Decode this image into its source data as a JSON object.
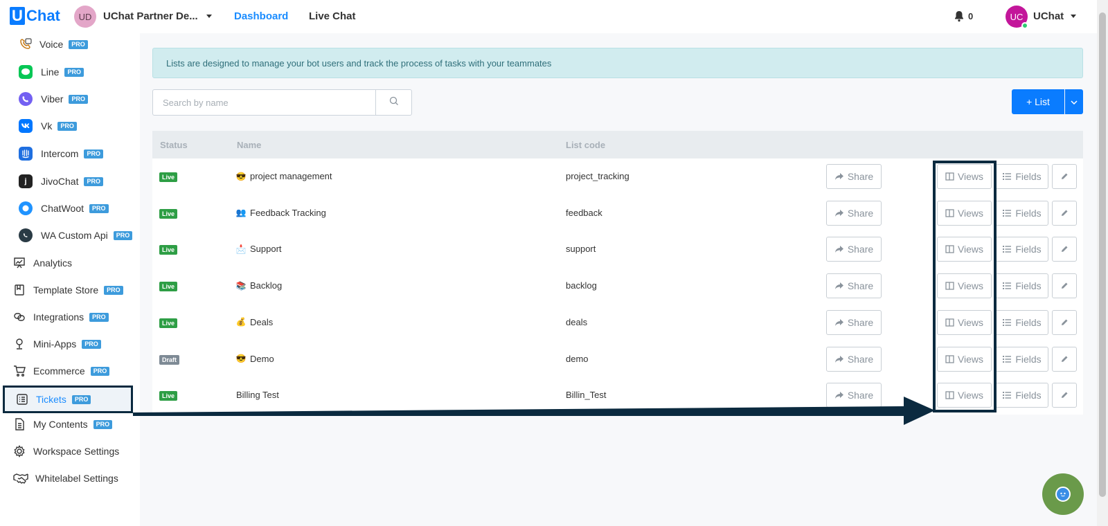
{
  "header": {
    "logo_letter": "U",
    "logo_text": "Chat",
    "workspace_initials": "UD",
    "workspace_name": "UChat Partner De...",
    "nav": {
      "dashboard": "Dashboard",
      "live_chat": "Live Chat"
    },
    "notification_count": "0",
    "user_initials": "UC",
    "user_name": "UChat"
  },
  "sidebar": {
    "pro_label": "PRO",
    "channels": [
      {
        "label": "Voice",
        "icon": "voice-icon",
        "color": "#f0a030"
      },
      {
        "label": "Line",
        "icon": "line-icon",
        "color": "#06c755"
      },
      {
        "label": "Viber",
        "icon": "viber-icon",
        "color": "#7360f2"
      },
      {
        "label": "Vk",
        "icon": "vk-icon",
        "color": "#0077ff"
      },
      {
        "label": "Intercom",
        "icon": "intercom-icon",
        "color": "#1f8ded"
      },
      {
        "label": "JivoChat",
        "icon": "jivochat-icon",
        "color": "#222222"
      },
      {
        "label": "ChatWoot",
        "icon": "chatwoot-icon",
        "color": "#1f93ff"
      },
      {
        "label": "WA Custom Api",
        "icon": "whatsapp-icon",
        "color": "#2a3b45"
      }
    ],
    "items": [
      {
        "label": "Analytics",
        "pro": false,
        "icon": "analytics-icon"
      },
      {
        "label": "Template Store",
        "pro": true,
        "icon": "template-store-icon"
      },
      {
        "label": "Integrations",
        "pro": true,
        "icon": "integrations-icon"
      },
      {
        "label": "Mini-Apps",
        "pro": true,
        "icon": "mini-apps-icon"
      },
      {
        "label": "Ecommerce",
        "pro": true,
        "icon": "ecommerce-icon"
      },
      {
        "label": "Tickets",
        "pro": true,
        "icon": "tickets-icon",
        "active": true
      },
      {
        "label": "My Contents",
        "pro": true,
        "icon": "my-contents-icon"
      },
      {
        "label": "Workspace Settings",
        "pro": false,
        "icon": "gear-icon"
      },
      {
        "label": "Whitelabel Settings",
        "pro": false,
        "icon": "handshake-icon"
      }
    ]
  },
  "main": {
    "alert": "Lists are designed to manage your bot users and track the process of tasks with your teammates",
    "search_placeholder": "Search by name",
    "add_list_label": "+ List",
    "columns": {
      "status": "Status",
      "name": "Name",
      "code": "List code"
    },
    "buttons": {
      "share": "Share",
      "views": "Views",
      "fields": "Fields"
    },
    "rows": [
      {
        "status": "Live",
        "name": "project management",
        "code": "project_tracking",
        "emoji": "😎"
      },
      {
        "status": "Live",
        "name": "Feedback Tracking",
        "code": "feedback",
        "emoji": "👥"
      },
      {
        "status": "Live",
        "name": "Support",
        "code": "support",
        "emoji": "📩"
      },
      {
        "status": "Live",
        "name": "Backlog",
        "code": "backlog",
        "emoji": "📚"
      },
      {
        "status": "Live",
        "name": "Deals",
        "code": "deals",
        "emoji": "💰"
      },
      {
        "status": "Draft",
        "name": "Demo",
        "code": "demo",
        "emoji": "😎"
      },
      {
        "status": "Live",
        "name": "Billing Test",
        "code": "Billin_Test",
        "emoji": ""
      }
    ]
  },
  "colors": {
    "accent": "#0a7cff",
    "live": "#2e9e45",
    "draft": "#7e8a95",
    "annotation": "#0b2a3f"
  }
}
